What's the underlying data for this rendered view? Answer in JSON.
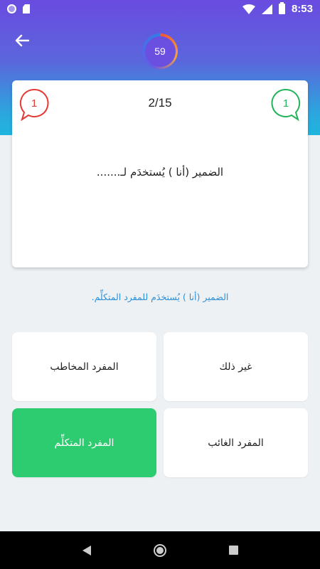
{
  "status_bar": {
    "time": "8:53"
  },
  "header": {
    "timer": "59"
  },
  "question_card": {
    "wrong_count": "1",
    "correct_count": "1",
    "progress": "2/15",
    "question": "الضمير (أنا ) يُستخدَم لـ......."
  },
  "explanation": "الضمير (أنا ) يُستخدَم للمفرد المتكلِّم.",
  "answers": [
    {
      "label": "غير ذلك"
    },
    {
      "label": "المفرد المخاطب"
    },
    {
      "label": "المفرد الغائب"
    },
    {
      "label": "المفرد المتكلِّم"
    }
  ],
  "colors": {
    "header_top": "#6a4be0",
    "header_bottom": "#1fb5de",
    "wrong": "#e53935",
    "correct": "#21b45a",
    "correct_answer_bg": "#2ecc71",
    "explanation": "#2e8fd8",
    "background": "#eef1f4"
  },
  "icons": {
    "back": "arrow-left-icon",
    "wrong_bubble": "speech-bubble-icon",
    "correct_bubble": "speech-bubble-icon",
    "nav_back": "triangle-back-icon",
    "nav_home": "circle-home-icon",
    "nav_recents": "square-recents-icon"
  }
}
